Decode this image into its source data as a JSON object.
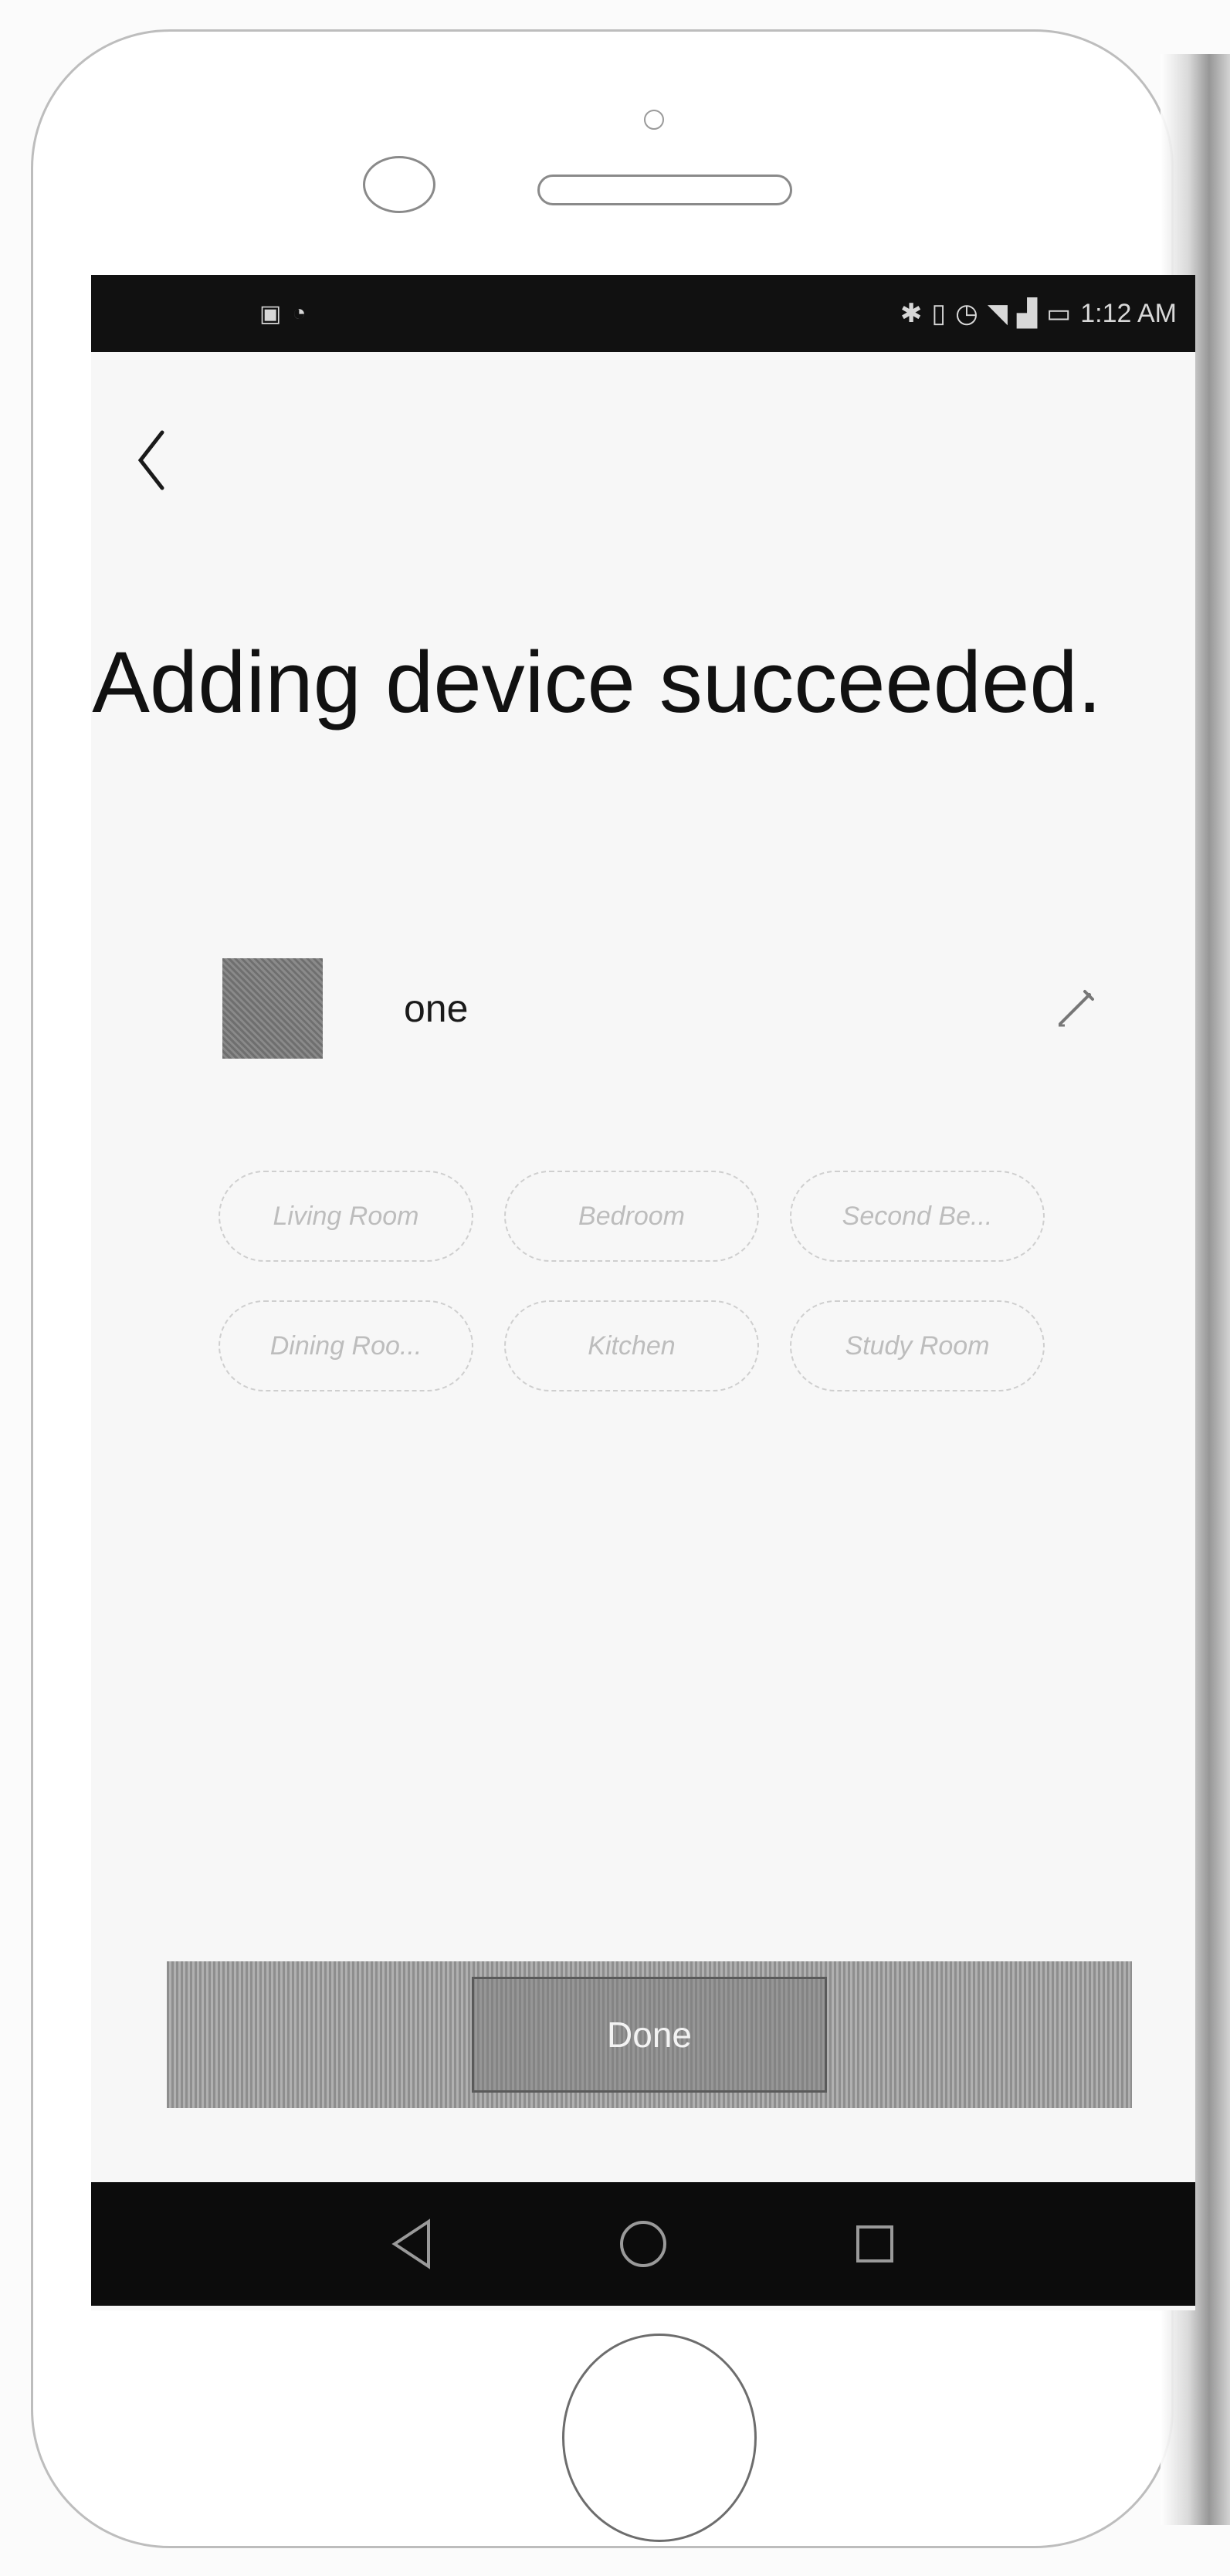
{
  "status_bar": {
    "carrier": "",
    "time": "1:12 AM"
  },
  "title": "Adding device succeeded.",
  "device": {
    "name": "one"
  },
  "rooms": [
    "Living Room",
    "Bedroom",
    "Second Be...",
    "Dining Roo...",
    "Kitchen",
    "Study Room"
  ],
  "done_label": "Done",
  "icons": {
    "back": "chevron-left-icon",
    "edit": "pencil-icon",
    "nav_back": "triangle-back-icon",
    "nav_home": "circle-home-icon",
    "nav_recents": "square-recents-icon"
  },
  "colors": {
    "status_bar": "#111111",
    "nav_bar": "#0c0c0c",
    "title_text": "#111111"
  }
}
